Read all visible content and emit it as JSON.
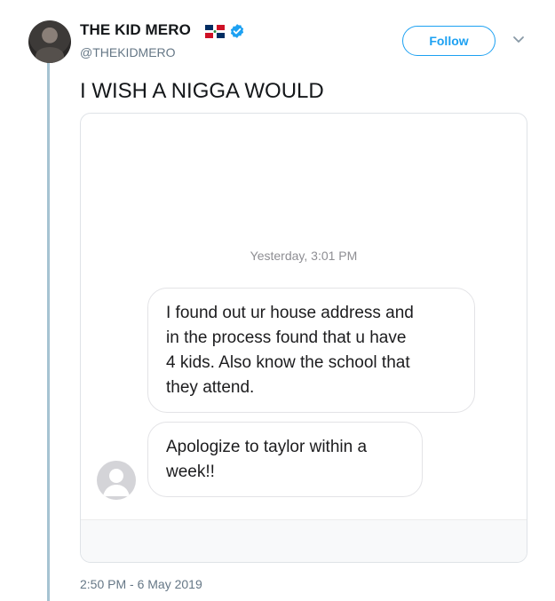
{
  "author": {
    "display_name": "THE KID MERO",
    "handle": "@THEKIDMERO",
    "flag_icon": "dominican-republic-flag-icon",
    "verified_icon": "verified-badge-icon"
  },
  "header": {
    "follow_label": "Follow",
    "menu_icon": "chevron-down-icon"
  },
  "tweet": {
    "text": "I WISH A NIGGA WOULD",
    "timestamp": "2:50 PM - 6 May 2019"
  },
  "media": {
    "conversation_time": "Yesterday, 3:01 PM",
    "messages": [
      {
        "lines": [
          "I found out ur house address and",
          "in the process found that u have",
          "4 kids. Also know the school that",
          "they attend."
        ]
      },
      {
        "lines": [
          "Apologize to taylor within a",
          "week!!"
        ]
      }
    ],
    "contact_icon": "contact-avatar-icon"
  },
  "colors": {
    "accent": "#1da1f2",
    "verified": "#1da1f2",
    "thread_line": "#a6c3d2",
    "secondary_text": "#657786"
  }
}
